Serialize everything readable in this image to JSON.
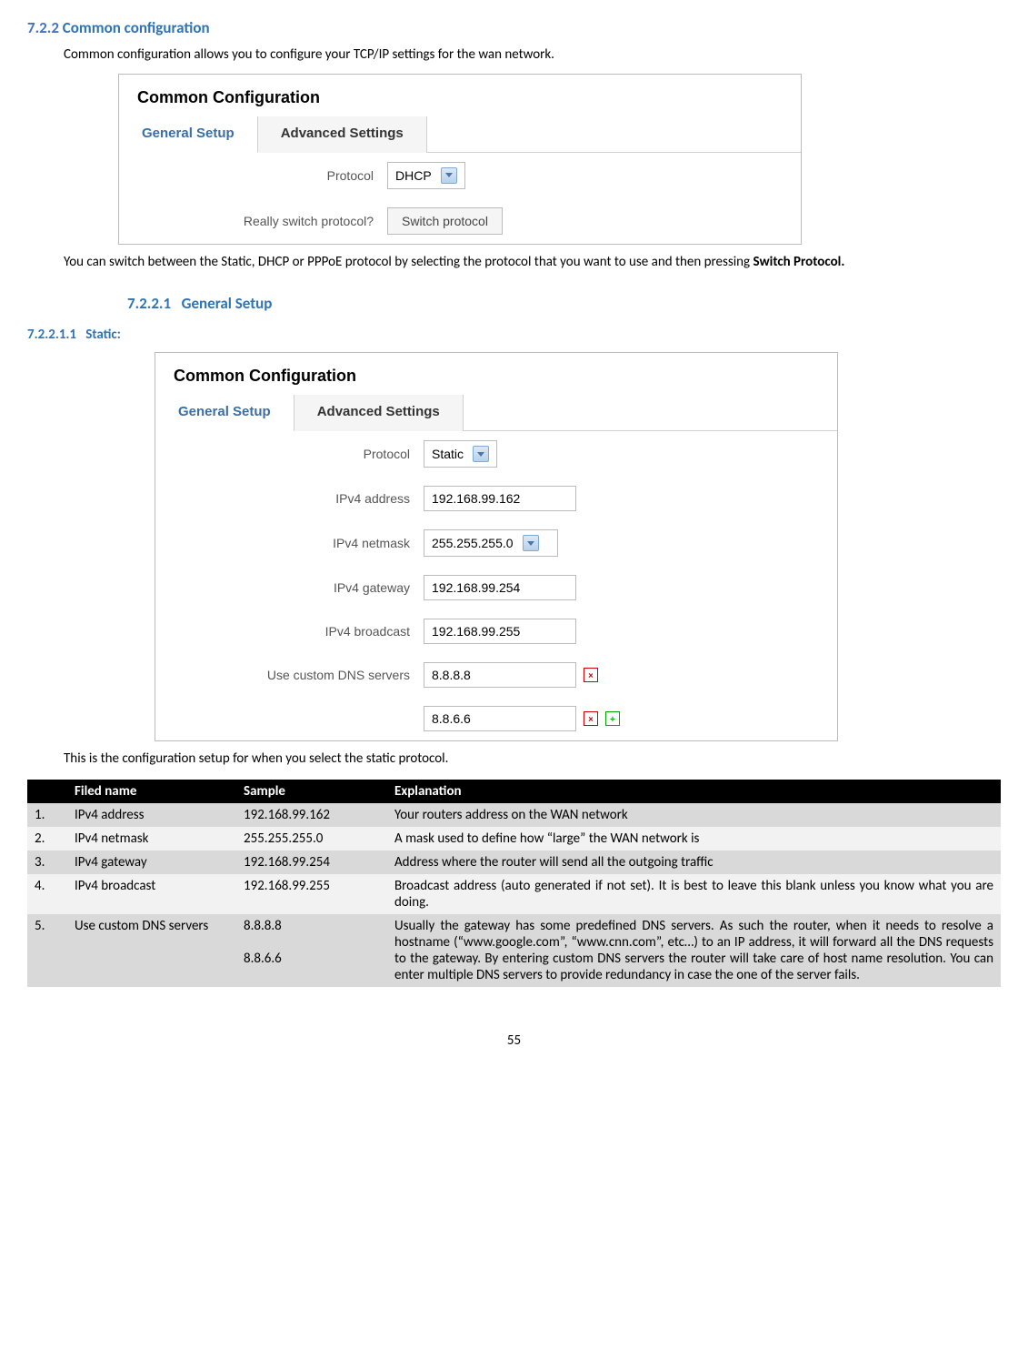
{
  "section": {
    "num": "7.2.2",
    "title": "Common configuration",
    "intro": "Common configuration allows you to configure your TCP/IP settings for the wan network."
  },
  "panel1": {
    "title": "Common Configuration",
    "tab_general": "General Setup",
    "tab_advanced": "Advanced Settings",
    "protocol_label": "Protocol",
    "protocol_value": "DHCP",
    "switch_label": "Really switch protocol?",
    "switch_button": "Switch protocol"
  },
  "switch_text_1": "You can switch between the Static, DHCP or PPPoE protocol by selecting the protocol that you want to use and then pressing ",
  "switch_text_bold": "Switch Protocol.",
  "subsection1": {
    "num": "7.2.2.1",
    "title": "General Setup"
  },
  "subsection2": {
    "num": "7.2.2.1.1",
    "title": "Static:"
  },
  "panel2": {
    "title": "Common Configuration",
    "tab_general": "General Setup",
    "tab_advanced": "Advanced Settings",
    "rows": {
      "protocol": {
        "label": "Protocol",
        "value": "Static"
      },
      "addr": {
        "label": "IPv4 address",
        "value": "192.168.99.162"
      },
      "netmask": {
        "label": "IPv4 netmask",
        "value": "255.255.255.0"
      },
      "gateway": {
        "label": "IPv4 gateway",
        "value": "192.168.99.254"
      },
      "broadcast": {
        "label": "IPv4 broadcast",
        "value": "192.168.99.255"
      },
      "dns": {
        "label": "Use custom DNS servers",
        "value1": "8.8.8.8",
        "value2": "8.8.6.6"
      }
    }
  },
  "panel2_caption": "This is the configuration setup for when you select the static protocol.",
  "table": {
    "headers": {
      "field": "Filed name",
      "sample": "Sample",
      "expl": "Explanation"
    },
    "rows": [
      {
        "n": "1.",
        "field": "IPv4 address",
        "sample": "192.168.99.162",
        "expl": "Your routers address on the WAN network"
      },
      {
        "n": "2.",
        "field": "IPv4 netmask",
        "sample": "255.255.255.0",
        "expl": "A mask used to define how “large” the WAN network is"
      },
      {
        "n": "3.",
        "field": "IPv4 gateway",
        "sample": "192.168.99.254",
        "expl": "Address where the router will send all the outgoing traffic"
      },
      {
        "n": "4.",
        "field": "IPv4 broadcast",
        "sample": "192.168.99.255",
        "expl": "Broadcast address (auto generated if not set). It is best to leave this blank unless you know what you are doing."
      },
      {
        "n": "5.",
        "field": "Use custom DNS servers",
        "sample": "8.8.8.8\n\n8.8.6.6",
        "expl": "Usually the gateway has some predefined DNS servers. As such the router, when it needs to resolve a hostname (“www.google.com”, “www.cnn.com”, etc…) to an IP address, it will forward all the DNS requests to the gateway. By entering custom DNS servers the router will take care of host name resolution. You can enter multiple DNS servers to provide redundancy in case the one of the server fails."
      }
    ]
  },
  "page_number": "55"
}
